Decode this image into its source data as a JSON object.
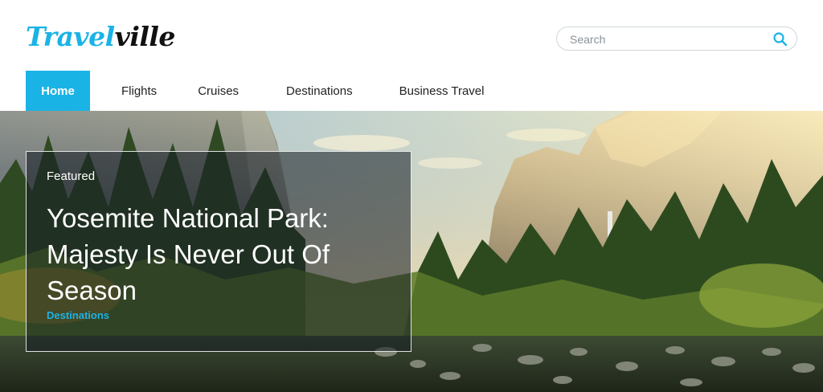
{
  "brand": {
    "logo_part1": "Travel",
    "logo_part2": "ville",
    "accent_color": "#1ab3e6"
  },
  "search": {
    "placeholder": "Search",
    "value": "",
    "icon": "search-icon"
  },
  "nav": {
    "items": [
      {
        "label": "Home",
        "active": true
      },
      {
        "label": "Flights",
        "active": false
      },
      {
        "label": "Cruises",
        "active": false
      },
      {
        "label": "Destinations",
        "active": false
      },
      {
        "label": "Business Travel",
        "active": false
      }
    ]
  },
  "hero": {
    "image": "yosemite-valley-landscape",
    "featured": {
      "label": "Featured",
      "title": "Yosemite National Park: Majesty Is Never Out Of Season",
      "category": "Destinations"
    }
  }
}
